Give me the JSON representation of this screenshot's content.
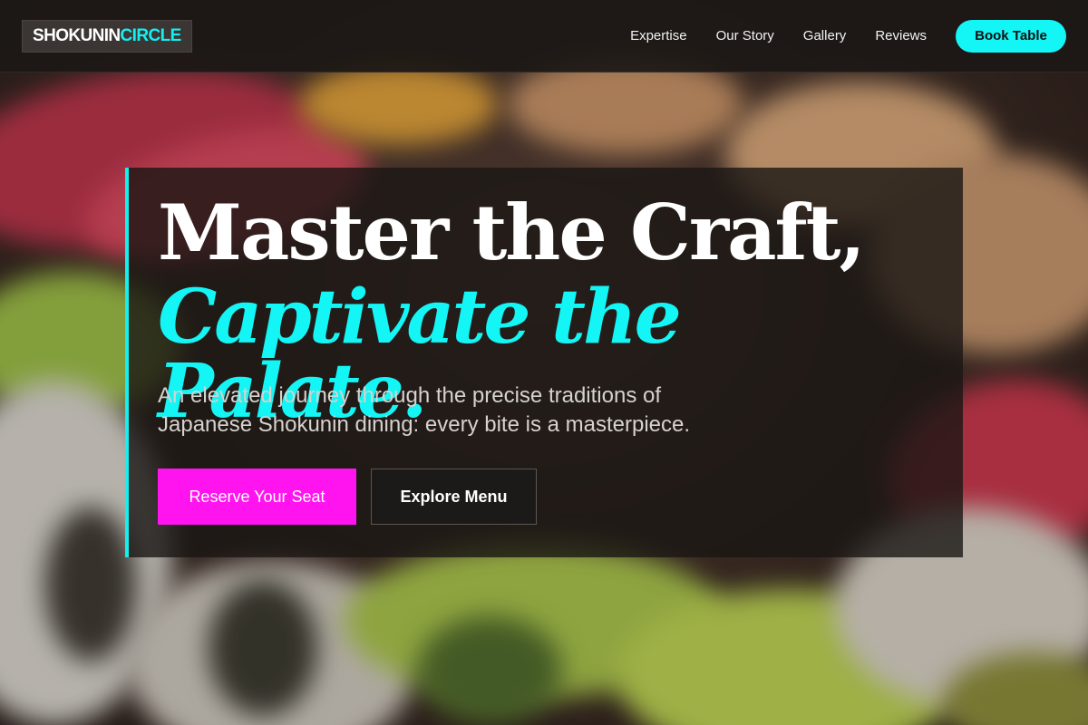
{
  "brand": {
    "logo_part_1": "SHOKUNIN",
    "logo_part_2": "CIRCLE"
  },
  "nav": {
    "links": [
      {
        "label": "Expertise"
      },
      {
        "label": "Our Story"
      },
      {
        "label": "Gallery"
      },
      {
        "label": "Reviews"
      }
    ],
    "cta_label": "Book Table"
  },
  "hero": {
    "headline_line_1": "Master the Craft,",
    "headline_line_2": "Captivate the Palate.",
    "subtext": "An elevated journey through the precise traditions of Japanese Shokunin dining: every bite is a masterpiece.",
    "primary_cta": "Reserve Your Seat",
    "secondary_cta": "Explore Menu",
    "background_image": "sushi-rolls-photo"
  },
  "colors": {
    "accent_cyan": "#14f5f5",
    "accent_magenta": "#ff14f0",
    "nav_background": "#1c1816"
  }
}
